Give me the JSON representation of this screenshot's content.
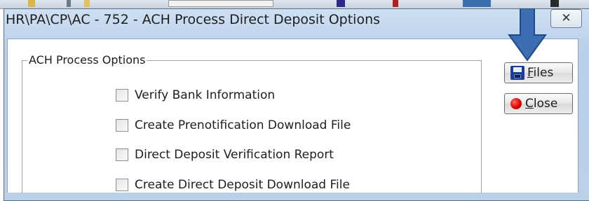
{
  "window": {
    "title": "HR\\PA\\CP\\AC - 752 - ACH Process Direct Deposit Options",
    "close_glyph": "✕"
  },
  "group": {
    "label": "ACH Process Options",
    "options": [
      {
        "label": "Verify Bank Information",
        "checked": false
      },
      {
        "label": "Create Prenotification Download File",
        "checked": false
      },
      {
        "label": "Direct Deposit Verification Report",
        "checked": false
      },
      {
        "label": "Create Direct Deposit Download File",
        "checked": false
      }
    ]
  },
  "buttons": {
    "files": {
      "mnemonic": "F",
      "rest": "iles",
      "icon": "floppy-disk-icon"
    },
    "close": {
      "mnemonic": "C",
      "rest": "lose",
      "icon": "stop-icon"
    }
  },
  "annotation": {
    "arrow_color": "#3d6eb4",
    "arrow_border": "#1f4b86"
  }
}
